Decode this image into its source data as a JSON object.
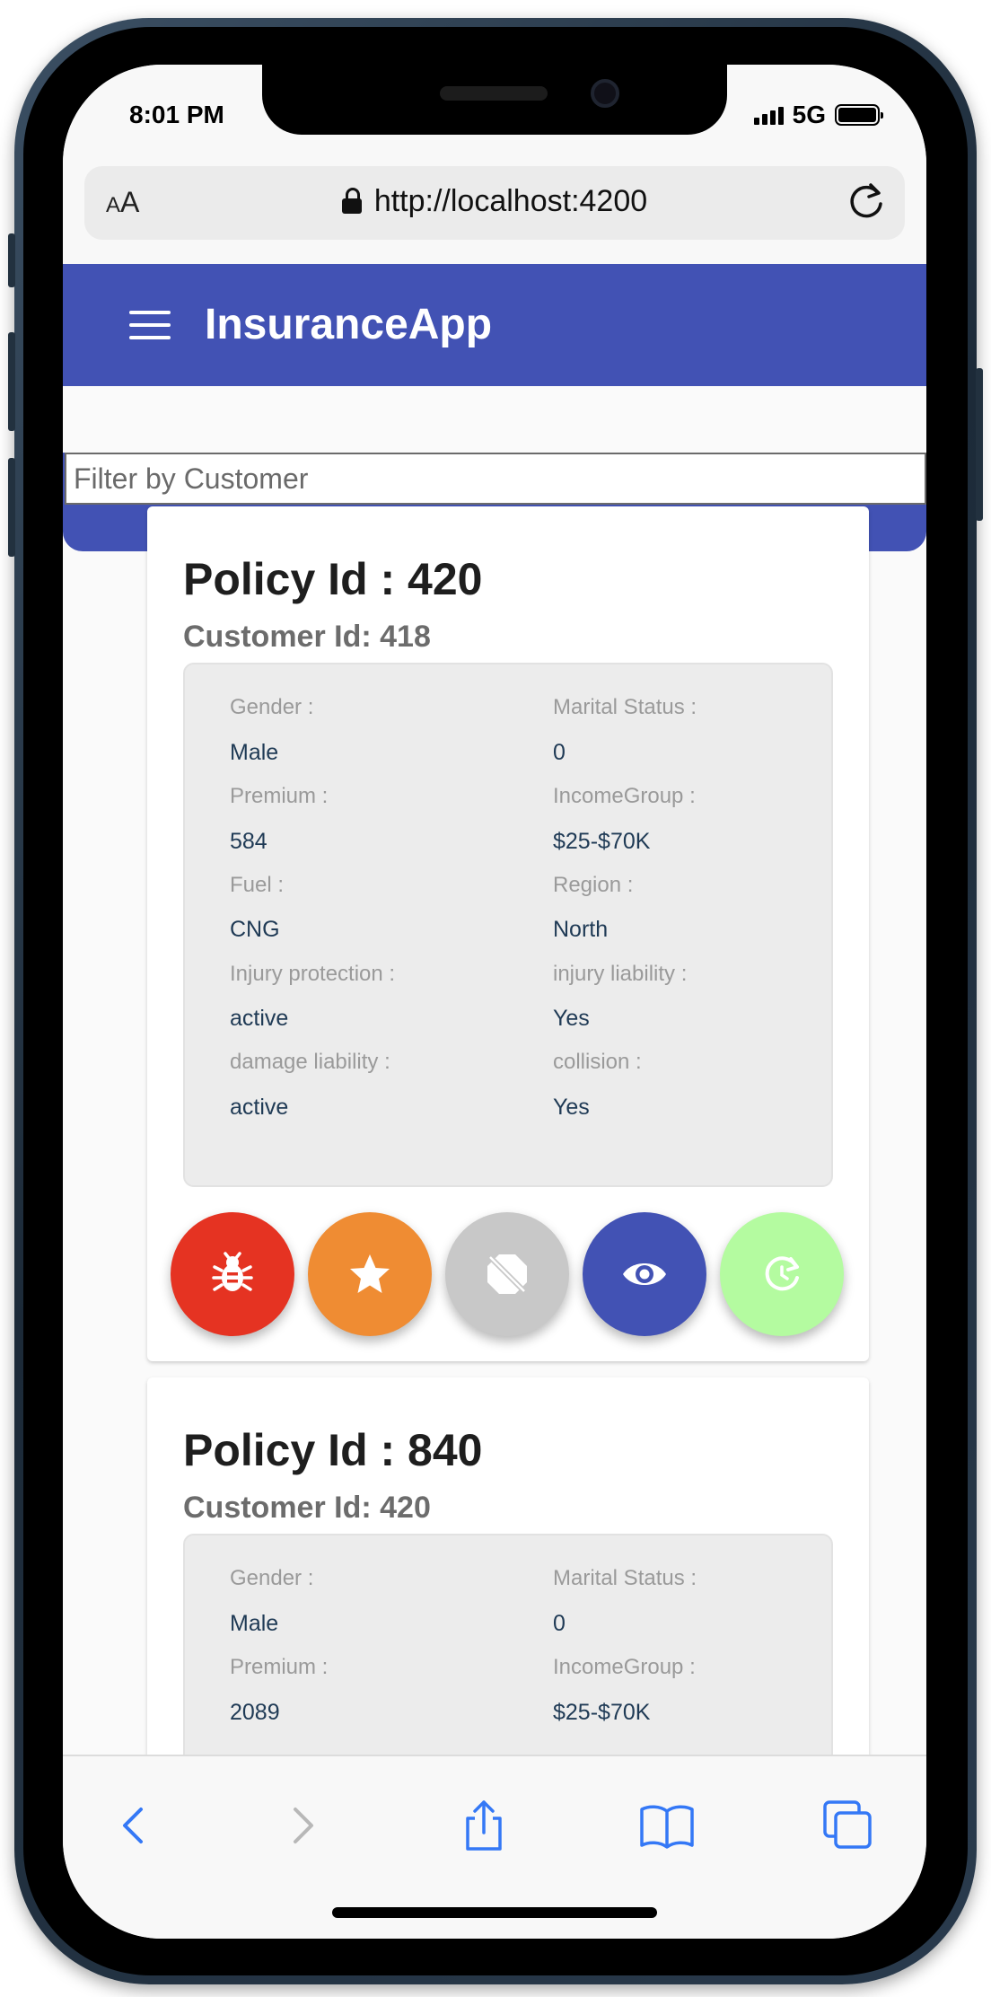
{
  "status_bar": {
    "time": "8:01 PM",
    "network": "5G"
  },
  "browser": {
    "aa_label": "AA",
    "url": "http://localhost:4200"
  },
  "app": {
    "title": "InsuranceApp"
  },
  "filter": {
    "placeholder": "Filter by Customer",
    "value": ""
  },
  "colors": {
    "toolbar": "#4252b4",
    "bug": "#e53322",
    "star": "#ef8c33",
    "disabled": "#c8c8c8",
    "eye": "#4252b4",
    "restore": "#b4fba0",
    "ios_blue": "#3478f6"
  },
  "policies": [
    {
      "policy_label": "Policy Id : 420",
      "customer_label": "Customer Id: 418",
      "fields": [
        {
          "label": "Gender :",
          "value": "Male"
        },
        {
          "label": "Marital Status :",
          "value": "0"
        },
        {
          "label": "Premium :",
          "value": "584"
        },
        {
          "label": "IncomeGroup :",
          "value": "$25-$70K"
        },
        {
          "label": "Fuel :",
          "value": "CNG"
        },
        {
          "label": "Region :",
          "value": "North"
        },
        {
          "label": "Injury protection :",
          "value": "active"
        },
        {
          "label": "injury liability :",
          "value": "Yes"
        },
        {
          "label": "damage liability :",
          "value": "active"
        },
        {
          "label": "collision :",
          "value": "Yes"
        }
      ],
      "actions": [
        "bug-icon",
        "star-icon",
        "block-icon",
        "eye-icon",
        "restore-icon"
      ]
    },
    {
      "policy_label": "Policy Id : 840",
      "customer_label": "Customer Id: 420",
      "fields": [
        {
          "label": "Gender :",
          "value": "Male"
        },
        {
          "label": "Marital Status :",
          "value": "0"
        },
        {
          "label": "Premium :",
          "value": "2089"
        },
        {
          "label": "IncomeGroup :",
          "value": "$25-$70K"
        }
      ]
    }
  ],
  "bottom_nav": [
    "back-icon",
    "forward-icon",
    "share-icon",
    "bookmarks-icon",
    "tabs-icon"
  ]
}
